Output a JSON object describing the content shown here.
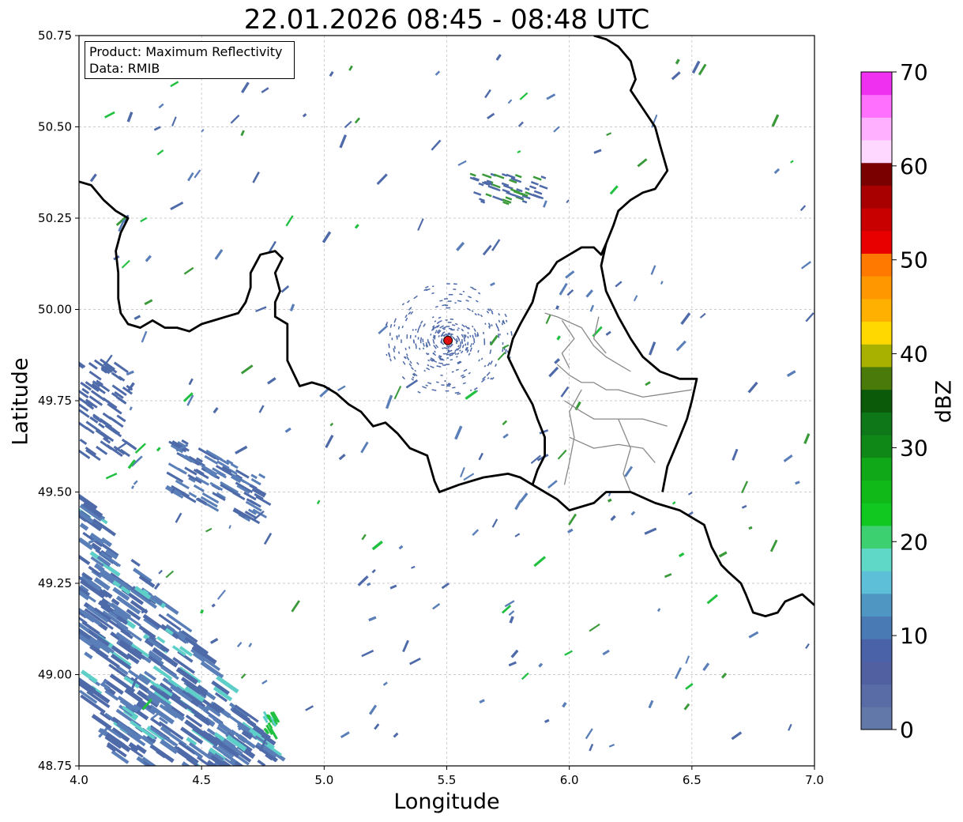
{
  "title": "22.01.2026 08:45 - 08:48 UTC",
  "info_box": {
    "product": "Product: Maximum Reflectivity",
    "data": "Data: RMIB"
  },
  "axes": {
    "xlabel": "Longitude",
    "ylabel": "Latitude",
    "xlim": [
      4.0,
      7.0
    ],
    "ylim": [
      48.75,
      50.75
    ],
    "xticks": [
      "4.0",
      "4.5",
      "5.0",
      "5.5",
      "6.0",
      "6.5",
      "7.0"
    ],
    "yticks": [
      "48.75",
      "49.00",
      "49.25",
      "49.50",
      "49.75",
      "50.00",
      "50.25",
      "50.50",
      "50.75"
    ],
    "grid": true
  },
  "radar_site": {
    "lon": 5.505,
    "lat": 49.915,
    "color": "#e01010"
  },
  "colorbar": {
    "label": "dBZ",
    "min": 0,
    "max": 70,
    "ticks": [
      "0",
      "10",
      "20",
      "30",
      "40",
      "50",
      "60",
      "70"
    ],
    "colors": [
      "#6278a8",
      "#5a6ca6",
      "#5060a0",
      "#4a62a8",
      "#4a7ab4",
      "#5096c2",
      "#5ec0d8",
      "#60d8c8",
      "#3cd070",
      "#10c820",
      "#10b818",
      "#10a818",
      "#108818",
      "#0e7818",
      "#0a5a0a",
      "#4a7a0a",
      "#a8b000",
      "#ffd800",
      "#ffb000",
      "#ff9800",
      "#ff7800",
      "#e80000",
      "#c80000",
      "#a80000",
      "#7a0000",
      "#ffd8ff",
      "#ffb0ff",
      "#ff70ff",
      "#f030f0"
    ]
  },
  "map_colors": {
    "border": "#000000",
    "province_lines": "#888888",
    "grid": "#bbbbbb"
  },
  "echo_colors": [
    "#4e6aa8",
    "#5a7fb8",
    "#3a9a3a",
    "#20c040",
    "#5ecfc8"
  ],
  "national_border": [
    [
      4.0,
      50.35
    ],
    [
      4.05,
      50.34
    ],
    [
      4.1,
      50.3
    ],
    [
      4.15,
      50.27
    ],
    [
      4.2,
      50.25
    ],
    [
      4.17,
      50.21
    ],
    [
      4.15,
      50.16
    ],
    [
      4.16,
      50.1
    ],
    [
      4.16,
      50.03
    ],
    [
      4.17,
      49.99
    ],
    [
      4.2,
      49.96
    ],
    [
      4.25,
      49.95
    ],
    [
      4.3,
      49.97
    ],
    [
      4.35,
      49.95
    ],
    [
      4.4,
      49.95
    ],
    [
      4.45,
      49.94
    ],
    [
      4.5,
      49.96
    ],
    [
      4.55,
      49.97
    ],
    [
      4.6,
      49.98
    ],
    [
      4.65,
      49.99
    ],
    [
      4.68,
      50.02
    ],
    [
      4.7,
      50.06
    ],
    [
      4.7,
      50.1
    ],
    [
      4.74,
      50.15
    ],
    [
      4.8,
      50.16
    ],
    [
      4.83,
      50.14
    ],
    [
      4.8,
      50.1
    ],
    [
      4.82,
      50.05
    ],
    [
      4.8,
      50.02
    ],
    [
      4.8,
      49.98
    ],
    [
      4.85,
      49.96
    ],
    [
      4.85,
      49.9
    ],
    [
      4.85,
      49.86
    ],
    [
      4.9,
      49.79
    ],
    [
      4.95,
      49.8
    ],
    [
      5.0,
      49.79
    ],
    [
      5.05,
      49.77
    ],
    [
      5.1,
      49.74
    ],
    [
      5.15,
      49.72
    ],
    [
      5.2,
      49.68
    ],
    [
      5.25,
      49.69
    ],
    [
      5.3,
      49.66
    ],
    [
      5.35,
      49.62
    ],
    [
      5.42,
      49.6
    ],
    [
      5.45,
      49.53
    ],
    [
      5.47,
      49.5
    ],
    [
      5.55,
      49.52
    ],
    [
      5.65,
      49.54
    ],
    [
      5.75,
      49.55
    ],
    [
      5.8,
      49.54
    ],
    [
      5.85,
      49.52
    ],
    [
      5.9,
      49.5
    ],
    [
      5.95,
      49.48
    ],
    [
      6.0,
      49.45
    ],
    [
      6.05,
      49.46
    ],
    [
      6.1,
      49.47
    ],
    [
      6.15,
      49.5
    ],
    [
      6.25,
      49.5
    ],
    [
      6.35,
      49.47
    ],
    [
      6.45,
      49.45
    ],
    [
      6.5,
      49.43
    ],
    [
      6.55,
      49.41
    ],
    [
      6.58,
      49.35
    ],
    [
      6.62,
      49.3
    ],
    [
      6.65,
      49.28
    ],
    [
      6.7,
      49.25
    ],
    [
      6.72,
      49.22
    ],
    [
      6.75,
      49.17
    ],
    [
      6.8,
      49.16
    ],
    [
      6.85,
      49.17
    ],
    [
      6.88,
      49.2
    ],
    [
      6.95,
      49.22
    ],
    [
      7.0,
      49.19
    ]
  ],
  "german_border": [
    [
      6.1,
      50.75
    ],
    [
      6.15,
      50.74
    ],
    [
      6.2,
      50.72
    ],
    [
      6.25,
      50.68
    ],
    [
      6.27,
      50.63
    ],
    [
      6.25,
      50.6
    ],
    [
      6.3,
      50.55
    ],
    [
      6.35,
      50.5
    ],
    [
      6.37,
      50.45
    ],
    [
      6.4,
      50.38
    ],
    [
      6.35,
      50.33
    ],
    [
      6.3,
      50.32
    ],
    [
      6.25,
      50.3
    ],
    [
      6.2,
      50.27
    ],
    [
      6.18,
      50.23
    ],
    [
      6.15,
      50.18
    ],
    [
      6.13,
      50.15
    ],
    [
      6.1,
      50.17
    ],
    [
      6.05,
      50.17
    ],
    [
      6.0,
      50.15
    ],
    [
      5.95,
      50.13
    ],
    [
      5.92,
      50.1
    ],
    [
      5.87,
      50.07
    ],
    [
      5.85,
      50.02
    ],
    [
      5.8,
      49.96
    ],
    [
      5.77,
      49.92
    ],
    [
      5.75,
      49.87
    ],
    [
      5.8,
      49.8
    ],
    [
      5.85,
      49.74
    ],
    [
      5.87,
      49.7
    ],
    [
      5.9,
      49.65
    ],
    [
      5.9,
      49.6
    ],
    [
      5.87,
      49.56
    ],
    [
      5.85,
      49.52
    ]
  ],
  "lux_east": [
    [
      6.15,
      50.18
    ],
    [
      6.13,
      50.12
    ],
    [
      6.15,
      50.05
    ],
    [
      6.2,
      49.98
    ],
    [
      6.25,
      49.92
    ],
    [
      6.3,
      49.87
    ],
    [
      6.37,
      49.83
    ],
    [
      6.45,
      49.81
    ],
    [
      6.52,
      49.81
    ],
    [
      6.5,
      49.75
    ],
    [
      6.48,
      49.7
    ],
    [
      6.45,
      49.65
    ],
    [
      6.4,
      49.57
    ],
    [
      6.38,
      49.5
    ]
  ],
  "province_lines": [
    [
      [
        5.9,
        49.99
      ],
      [
        5.95,
        49.98
      ],
      [
        6.05,
        49.95
      ],
      [
        6.1,
        49.9
      ],
      [
        6.15,
        49.87
      ],
      [
        6.2,
        49.85
      ],
      [
        6.25,
        49.83
      ]
    ],
    [
      [
        5.95,
        49.85
      ],
      [
        6.0,
        49.82
      ],
      [
        6.05,
        49.8
      ],
      [
        6.1,
        49.8
      ],
      [
        6.15,
        49.78
      ],
      [
        6.2,
        49.78
      ],
      [
        6.3,
        49.76
      ],
      [
        6.4,
        49.77
      ],
      [
        6.5,
        49.78
      ]
    ],
    [
      [
        5.98,
        49.75
      ],
      [
        6.05,
        49.72
      ],
      [
        6.1,
        49.7
      ],
      [
        6.2,
        49.7
      ],
      [
        6.3,
        49.7
      ],
      [
        6.4,
        49.68
      ]
    ],
    [
      [
        6.0,
        49.65
      ],
      [
        6.1,
        49.62
      ],
      [
        6.2,
        49.63
      ],
      [
        6.3,
        49.62
      ],
      [
        6.35,
        49.58
      ]
    ],
    [
      [
        6.05,
        49.78
      ],
      [
        6.0,
        49.72
      ],
      [
        6.02,
        49.65
      ],
      [
        6.0,
        49.58
      ],
      [
        5.98,
        49.52
      ]
    ],
    [
      [
        6.2,
        49.7
      ],
      [
        6.25,
        49.62
      ],
      [
        6.22,
        49.55
      ],
      [
        6.25,
        49.5
      ]
    ],
    [
      [
        5.97,
        49.97
      ],
      [
        6.02,
        49.92
      ],
      [
        5.97,
        49.88
      ],
      [
        6.0,
        49.84
      ]
    ],
    [
      [
        6.12,
        49.98
      ],
      [
        6.1,
        49.92
      ],
      [
        6.15,
        49.88
      ]
    ]
  ]
}
